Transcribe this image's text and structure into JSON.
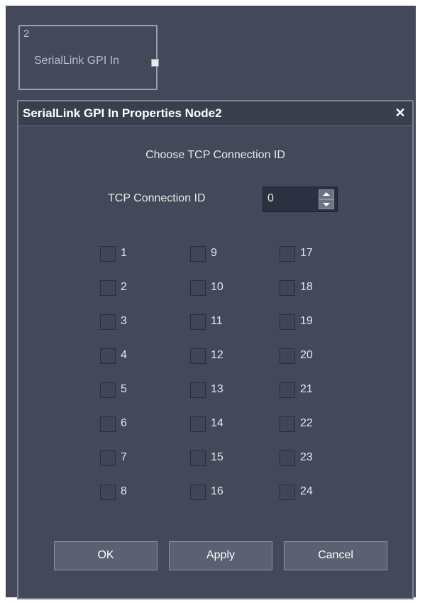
{
  "node": {
    "number": "2",
    "label": "SerialLink GPI In"
  },
  "dialog": {
    "title": "SerialLink GPI In Properties Node2",
    "close_glyph": "✕",
    "heading": "Choose TCP Connection ID",
    "tcp_label": "TCP Connection ID",
    "tcp_value": "0",
    "checkboxes": [
      "1",
      "2",
      "3",
      "4",
      "5",
      "6",
      "7",
      "8",
      "9",
      "10",
      "11",
      "12",
      "13",
      "14",
      "15",
      "16",
      "17",
      "18",
      "19",
      "20",
      "21",
      "22",
      "23",
      "24"
    ],
    "buttons": {
      "ok": "OK",
      "apply": "Apply",
      "cancel": "Cancel"
    }
  },
  "colors": {
    "canvas": "#43495a",
    "titlebar": "#3a3f4e",
    "button": "#5b6172",
    "text": "#e8e8e8"
  }
}
